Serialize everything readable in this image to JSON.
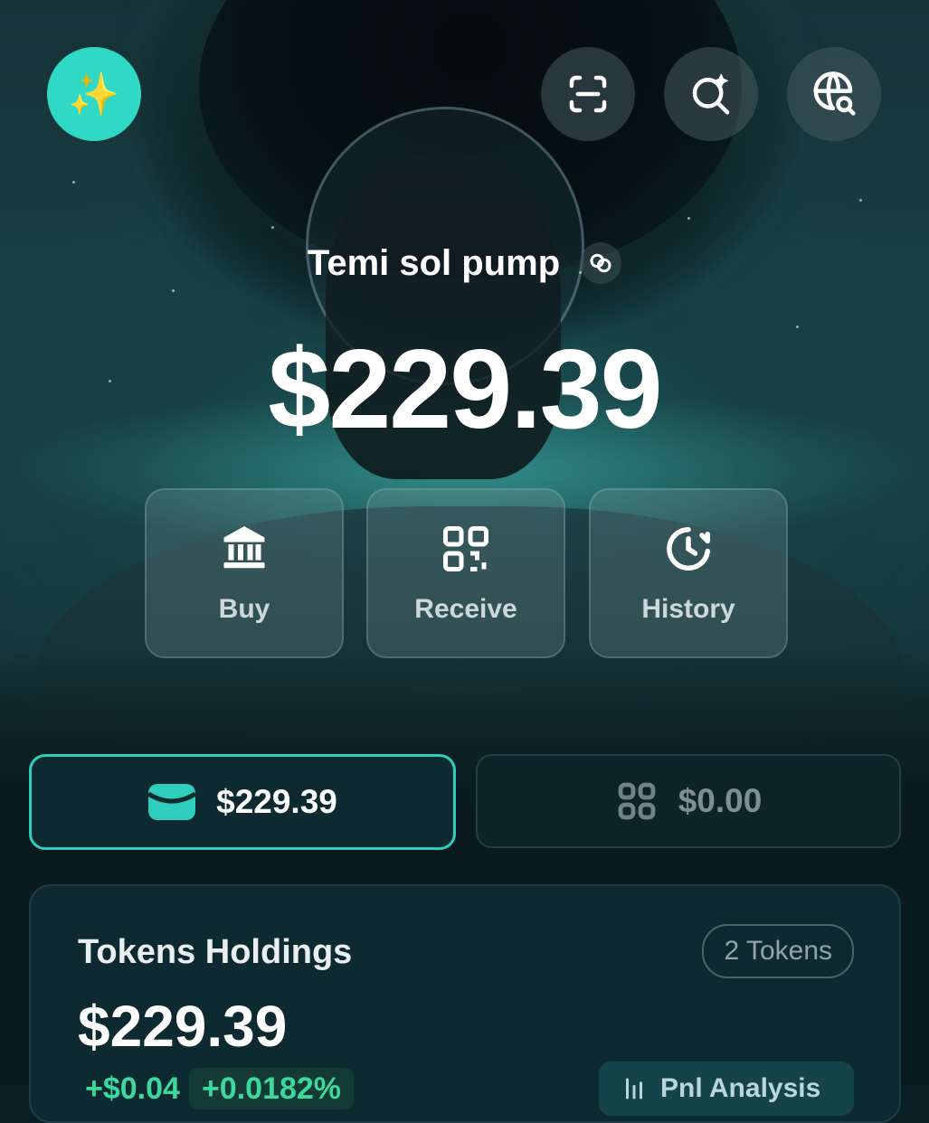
{
  "header": {
    "logo_glyph": "✨",
    "logo_color": "#2fd9c6",
    "icons": [
      "scan-icon",
      "ai-search-icon",
      "web-search-icon"
    ]
  },
  "wallet": {
    "name": "Temi sol pump",
    "balance": "$229.39"
  },
  "actions": [
    {
      "label": "Buy",
      "icon": "bank-icon"
    },
    {
      "label": "Receive",
      "icon": "qr-code-icon"
    },
    {
      "label": "History",
      "icon": "history-icon"
    }
  ],
  "tabs": [
    {
      "label": "$229.39",
      "icon": "wallet-icon",
      "active": true
    },
    {
      "label": "$0.00",
      "icon": "grid-icon",
      "active": false
    }
  ],
  "holdings": {
    "title": "Tokens Holdings",
    "token_count": "2 Tokens",
    "value": "$229.39",
    "change_value": "+$0.04",
    "change_pct": "+0.0182%",
    "analysis_label": "Pnl Analysis"
  },
  "colors": {
    "accent": "#2fcdbb",
    "positive": "#3bd99d",
    "background": "#0a1f24"
  }
}
